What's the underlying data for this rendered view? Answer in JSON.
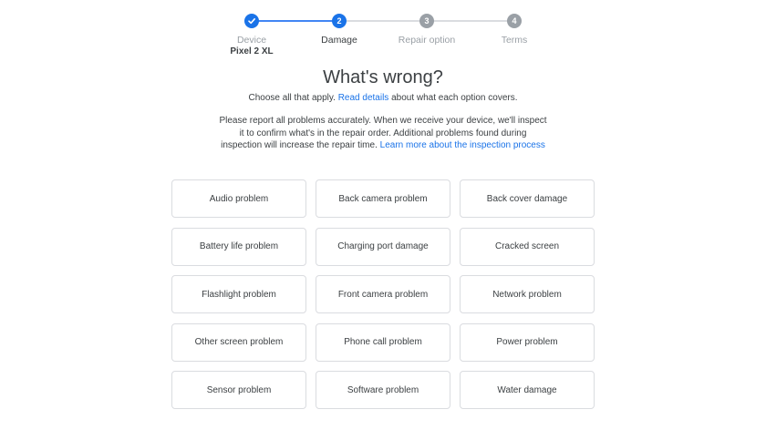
{
  "stepper": {
    "steps": [
      {
        "number": "✓",
        "label": "Device",
        "sublabel": "Pixel 2 XL",
        "state": "complete"
      },
      {
        "number": "2",
        "label": "Damage",
        "sublabel": "",
        "state": "active"
      },
      {
        "number": "3",
        "label": "Repair option",
        "sublabel": "",
        "state": "pending"
      },
      {
        "number": "4",
        "label": "Terms",
        "sublabel": "",
        "state": "pending"
      }
    ]
  },
  "heading": {
    "title": "What's wrong?",
    "subtitle_before": "Choose all that apply. ",
    "subtitle_link": "Read details",
    "subtitle_after": " about what each option covers.",
    "notice_text": "Please report all problems accurately. When we receive your device, we'll inspect it to confirm what's in the repair order. Additional problems found during inspection will increase the repair time. ",
    "notice_link": "Learn more about the inspection process"
  },
  "options": [
    "Audio problem",
    "Back camera problem",
    "Back cover damage",
    "Battery life problem",
    "Charging port damage",
    "Cracked screen",
    "Flashlight problem",
    "Front camera problem",
    "Network problem",
    "Other screen problem",
    "Phone call problem",
    "Power problem",
    "Sensor problem",
    "Software problem",
    "Water damage"
  ],
  "colors": {
    "accent": "#1a73e8",
    "border": "#dadce0",
    "text": "#3c4043",
    "muted": "#9aa0a6"
  }
}
